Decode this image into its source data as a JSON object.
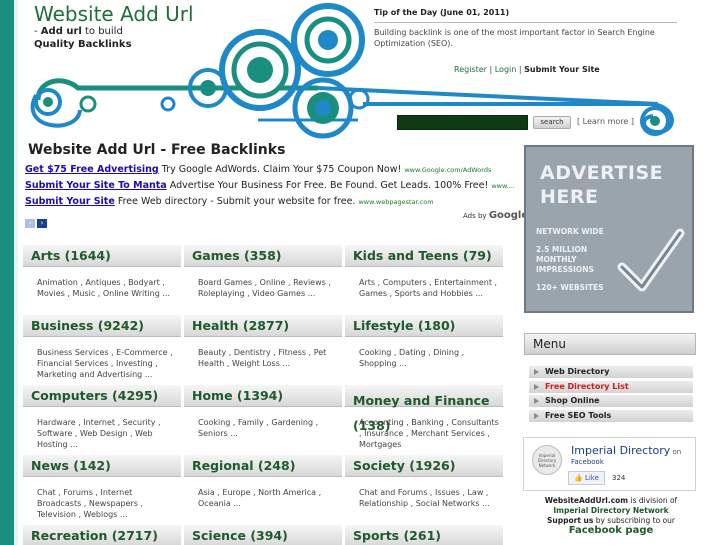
{
  "header": {
    "site_title": "Website Add Url",
    "tagline_prefix": "- ",
    "tagline_bold": "Add url",
    "tagline_rest": " to build",
    "tagline_line2": "Quality Backlinks",
    "tip_title": "Tip of the Day (June 01, 2011)",
    "tip_text": "Building backlink is one of the most important factor in Search Engine Optimization (SEO).",
    "nav": {
      "register": "Register",
      "login": "Login",
      "submit": "Submit Your Site",
      "sep": "|"
    },
    "search_button": "search",
    "learn_more": "[ Learn more ]"
  },
  "main": {
    "heading": "Website Add Url - Free Backlinks",
    "ads": [
      {
        "link": "Get $75 Free Advertising",
        "text": " Try Google AdWords. Claim Your $75 Coupon Now! ",
        "url": "www.Google.com/AdWords"
      },
      {
        "link": "Submit Your Site To Manta",
        "text": " Advertise Your Business For Free. Be Found. Get Leads. 100% Free! ",
        "url": "www...."
      },
      {
        "link": "Submit Your Site",
        "text": " Free Web directory - Submit your website for free. ",
        "url": "www.webpagestar.com"
      }
    ],
    "ads_by": "Ads by",
    "ads_by_brand": "Google",
    "ad_prev": "‹",
    "ad_next": "›",
    "categories": [
      {
        "title": "Arts  (1644)",
        "sub": "Animation , Antiques , Bodyart , Movies , Music , Online Writing ..."
      },
      {
        "title": "Games  (358)",
        "sub": "Board Games , Online , Reviews , Roleplaying , Video Games ..."
      },
      {
        "title": "Kids and Teens  (79)",
        "sub": "Arts , Computers , Entertainment , Games , Sports and Hobbies ..."
      },
      {
        "title": "Business  (9242)",
        "sub": "Business Services , E-Commerce , Financial Services , Investing , Marketing and Advertising ..."
      },
      {
        "title": "Health  (2877)",
        "sub": "Beauty , Dentistry , Fitness , Pet Health , Weight Loss ..."
      },
      {
        "title": "Lifestyle  (180)",
        "sub": "Cooking , Dating , Dining , Shopping ..."
      },
      {
        "title": "Computers  (4295)",
        "sub": "Hardware , Internet , Security , Software , Web Design , Web Hosting ..."
      },
      {
        "title": "Home  (1394)",
        "sub": "Cooking , Family , Gardening , Seniors ..."
      },
      {
        "title": "Money and Finance  (138)",
        "sub": "Accounting , Banking , Consultants , Insurance , Merchant Services , Mortgages"
      },
      {
        "title": "News  (142)",
        "sub": "Chat , Forums , Internet Broadcasts , Newspapers , Television , Weblogs ..."
      },
      {
        "title": "Regional  (248)",
        "sub": "Asia , Europe , North America , Oceania ..."
      },
      {
        "title": "Society  (1926)",
        "sub": "Chat and Forums , Issues , Law , Relationship , Social Networks ..."
      },
      {
        "title": "Recreation  (2717)",
        "sub": ""
      },
      {
        "title": "Science  (394)",
        "sub": ""
      },
      {
        "title": "Sports  (261)",
        "sub": ""
      }
    ]
  },
  "sidebar": {
    "ad_title_1": "ADVERTISE",
    "ad_title_2": "HERE",
    "ad_network": "NETWORK WIDE",
    "ad_l1": "2.5 MILLION",
    "ad_l2": "MONTHLY",
    "ad_l3": "IMPRESSIONS",
    "ad_sites": "120+ WEBSITES",
    "menu_title": "Menu",
    "menu_items": [
      {
        "label": "Web Directory",
        "highlight": false
      },
      {
        "label": "Free Directory List",
        "highlight": true
      },
      {
        "label": "Shop Online",
        "highlight": false
      },
      {
        "label": "Free SEO Tools",
        "highlight": false
      }
    ],
    "fb_name": "Imperial Directory",
    "fb_on": " on",
    "fb_site": "Facebook",
    "fb_logo_text": "Imperial Directory Network",
    "fb_like": "Like",
    "fb_count": "324",
    "division_1_bold": "WebsiteAddUrl.com",
    "division_1_rest": " is division of",
    "division_2": "Imperial Directory Network",
    "division_3_bold": "Support us",
    "division_3_rest": " by subscribing to our",
    "division_4": "Facebook page"
  },
  "colors": {
    "brand_green": "#1f6e3c",
    "accent_teal": "#1a8f7f",
    "ad_link": "#1a0dab",
    "highlight_red": "#d11a1a"
  }
}
